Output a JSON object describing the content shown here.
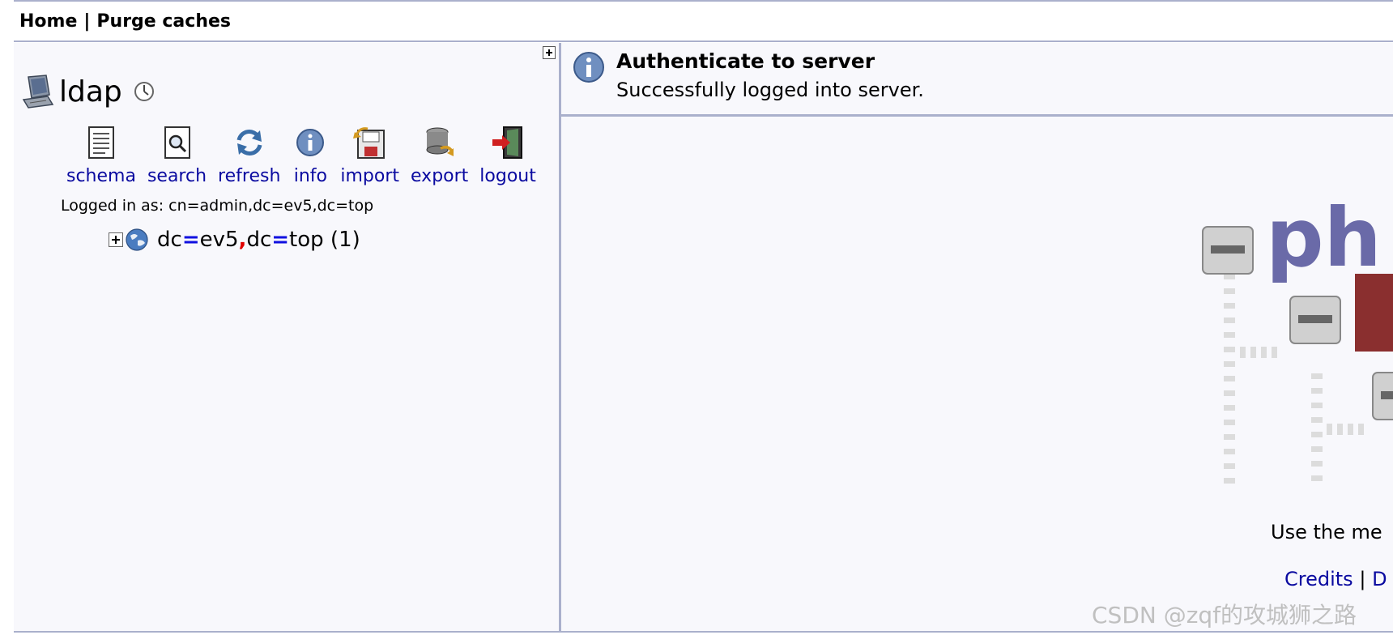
{
  "nav": {
    "home": "Home",
    "separator": "|",
    "purge": "Purge caches"
  },
  "server": {
    "name": "ldap"
  },
  "toolbar": {
    "schema": "schema",
    "search": "search",
    "refresh": "refresh",
    "info": "info",
    "import": "import",
    "export": "export",
    "logout": "logout"
  },
  "login": {
    "text": "Logged in as: cn=admin,dc=ev5,dc=top"
  },
  "tree": {
    "dn_part1_attr": "dc",
    "dn_part1_val": "ev5",
    "dn_part2_attr": "dc",
    "dn_part2_val": "top",
    "eq": "=",
    "comma": ",",
    "count": "(1)"
  },
  "notice": {
    "title": "Authenticate to server",
    "message": "Successfully logged into server."
  },
  "main": {
    "hint": "Use the me",
    "credits": "Credits",
    "separator": "|",
    "next_link": "D"
  },
  "watermark": "CSDN @zqf的攻城狮之路",
  "colors": {
    "link": "#0a0aa0",
    "border": "#aab0cc",
    "panel_bg": "#f8f8fc",
    "dn_eq": "#1010e0",
    "dn_comma": "#e00000"
  }
}
